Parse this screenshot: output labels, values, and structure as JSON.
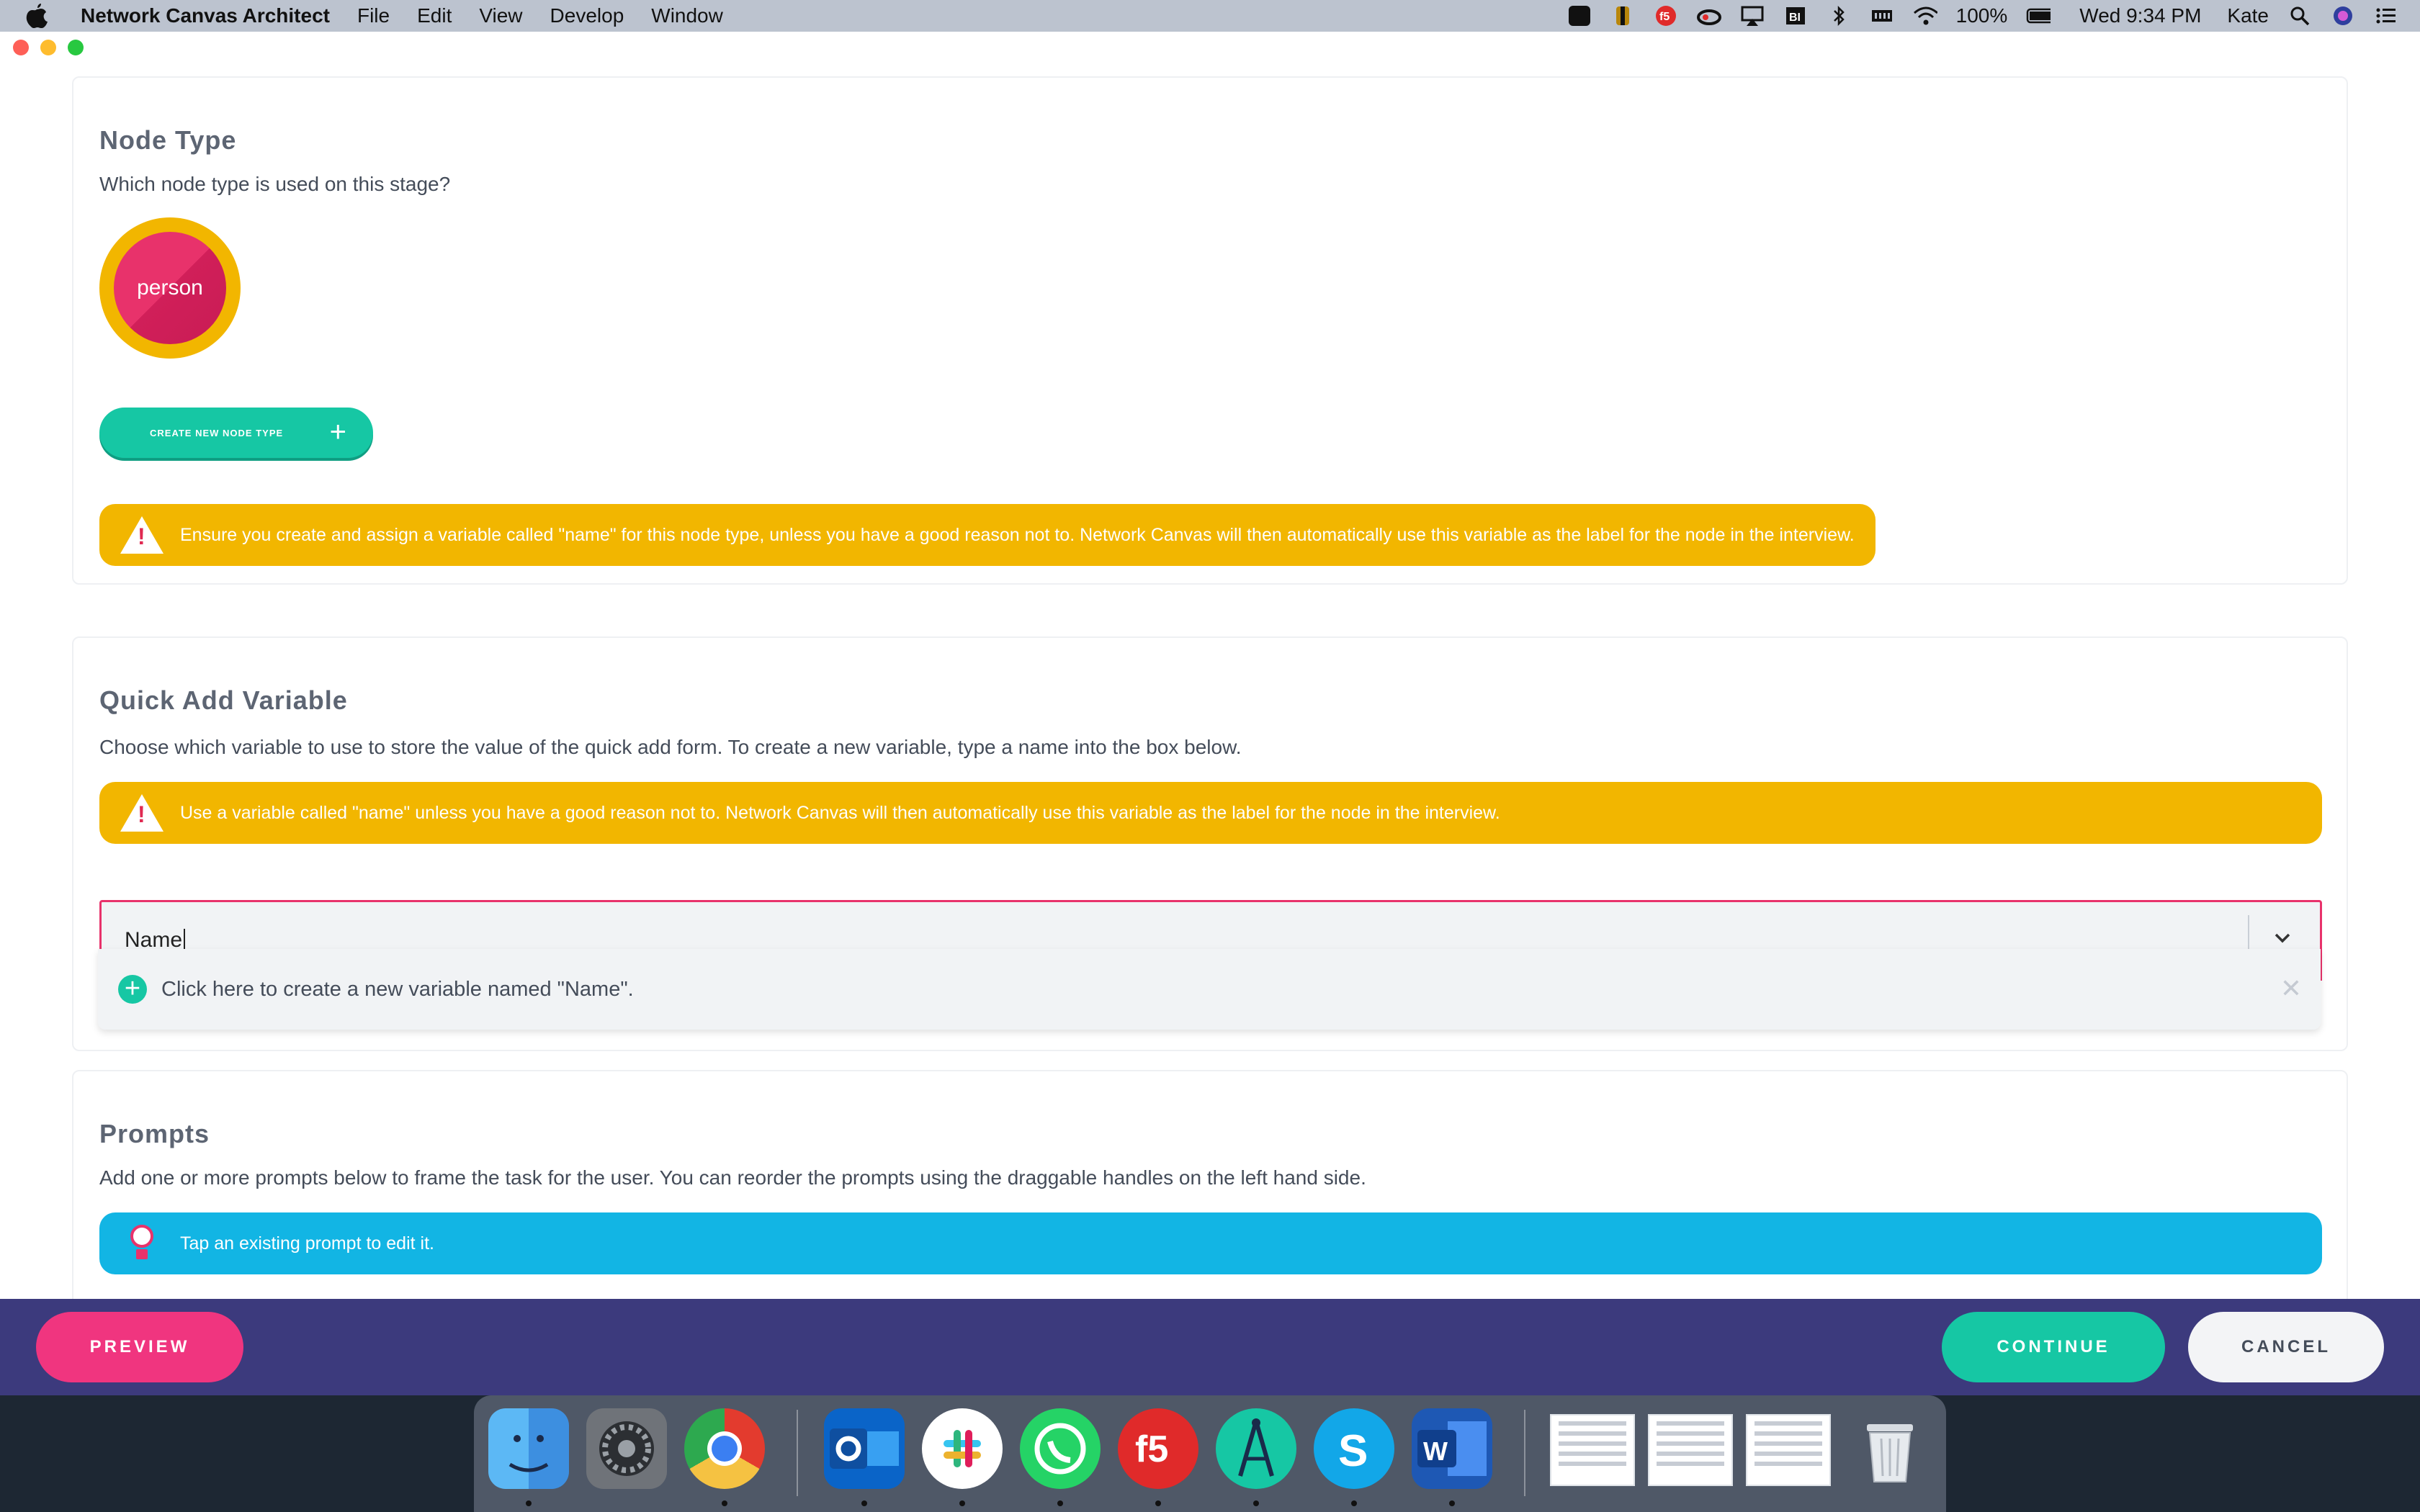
{
  "menubar": {
    "app_name": "Network Canvas Architect",
    "menus": [
      "File",
      "Edit",
      "View",
      "Develop",
      "Window"
    ],
    "battery": "100%",
    "clock": "Wed 9:34 PM",
    "user": "Kate",
    "status_icons": [
      "checkmark-shield-icon",
      "vpn-icon",
      "f5-icon",
      "creative-cloud-icon",
      "airplay-icon",
      "bi-icon",
      "bluetooth-icon",
      "memory-icon",
      "wifi-icon",
      "battery-icon",
      "search-icon",
      "siri-icon",
      "list-icon"
    ]
  },
  "node_type": {
    "title": "Node Type",
    "description": "Which node type is used on this stage?",
    "node_label": "person",
    "node_colors": {
      "ring": "#f2b600",
      "fill": "#e8326b"
    },
    "create_button": "CREATE NEW NODE TYPE",
    "warning": "Ensure you create and assign a variable called \"name\" for this node type, unless you have a good reason not to. Network Canvas will then automatically use this variable as the label for the node in the interview."
  },
  "quick_add": {
    "title": "Quick Add Variable",
    "description": "Choose which variable to use to store the value of the quick add form. To create a new variable, type a name into the box below.",
    "warning": "Use a variable called \"name\" unless you have a good reason not to. Network Canvas will then automatically use this variable as the label for the node in the interview.",
    "input_value": "Name",
    "create_option": "Click here to create a new variable named \"Name\"."
  },
  "prompts": {
    "title": "Prompts",
    "description": "Add one or more prompts below to frame the task for the user. You can reorder the prompts using the draggable handles on the left hand side.",
    "info": "Tap an existing prompt to edit it."
  },
  "controls": {
    "preview": "PREVIEW",
    "continue": "CONTINUE",
    "cancel": "CANCEL"
  },
  "dock": {
    "apps": [
      "finder-icon",
      "system-preferences-icon",
      "chrome-icon",
      "outlook-icon",
      "slack-icon",
      "whatsapp-icon",
      "f5-icon",
      "network-canvas-architect-icon",
      "skype-icon",
      "word-icon",
      "trash-icon"
    ]
  },
  "colors": {
    "accent_teal": "#16c7a4",
    "warning_yellow": "#f2b600",
    "info_blue": "#12b5e4",
    "pink": "#f0357f",
    "control_bar": "#3c3a7d"
  }
}
